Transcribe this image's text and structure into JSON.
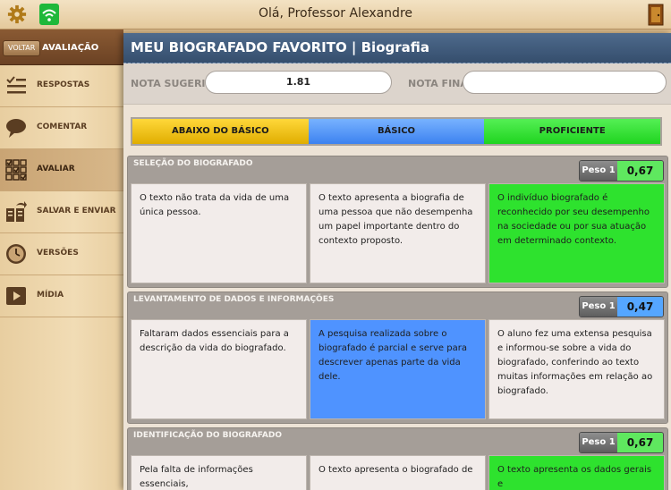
{
  "topbar": {
    "greeting": "Olá, Professor Alexandre"
  },
  "sidebar": {
    "back_label": "VOLTAR",
    "section_label": "AVALIAÇÃO",
    "items": [
      {
        "label": "RESPOSTAS",
        "icon": "checklist-icon"
      },
      {
        "label": "COMENTAR",
        "icon": "speech-bubble-icon"
      },
      {
        "label": "AVALIAR",
        "icon": "grid-check-icon",
        "active": true
      },
      {
        "label": "SALVAR E ENVIAR",
        "icon": "save-send-icon"
      },
      {
        "label": "VERSÕES",
        "icon": "clock-icon"
      },
      {
        "label": "MÍDIA",
        "icon": "play-icon"
      }
    ]
  },
  "main": {
    "title": "MEU BIOGRAFADO FAVORITO | Biografia",
    "nota_sugerida_label": "NOTA SUGERIDA",
    "nota_sugerida_value": "1.81",
    "nota_final_label": "NOTA FINAL",
    "nota_final_value": "",
    "levels": [
      "ABAIXO DO BÁSICO",
      "BÁSICO",
      "PROFICIENTE"
    ],
    "level_colors": [
      "#f5c400",
      "#4f93ff",
      "#2ee22e"
    ],
    "sections": [
      {
        "title": "SELEÇÃO DO BIOGRAFADO",
        "peso_label": "Peso 1",
        "peso_value": "0,67",
        "cells": [
          "O texto não trata da vida de uma única pessoa.",
          "O texto apresenta a biografia de uma pessoa que não desempenha um papel importante dentro do contexto proposto.",
          "O indivíduo biografado é reconhecido por seu desempenho na sociedade ou por sua atuação em determinado contexto."
        ],
        "selected": 2
      },
      {
        "title": "LEVANTAMENTO DE DADOS E INFORMAÇÕES",
        "peso_label": "Peso 1",
        "peso_value": "0,47",
        "cells": [
          "Faltaram dados essenciais para a descrição da vida do biografado.",
          "A pesquisa realizada sobre o biografado é parcial e serve para descrever apenas parte da vida dele.",
          "O aluno fez uma extensa pesquisa e informou-se sobre a vida do biografado, conferindo ao texto muitas informações em relação ao biografado."
        ],
        "selected": 1
      },
      {
        "title": "IDENTIFICAÇÃO DO BIOGRAFADO",
        "peso_label": "Peso 1",
        "peso_value": "0,67",
        "cells": [
          "Pela falta de informações essenciais,",
          "O texto apresenta o biografado de",
          "O texto apresenta os dados gerais e"
        ],
        "selected": 2
      }
    ]
  }
}
